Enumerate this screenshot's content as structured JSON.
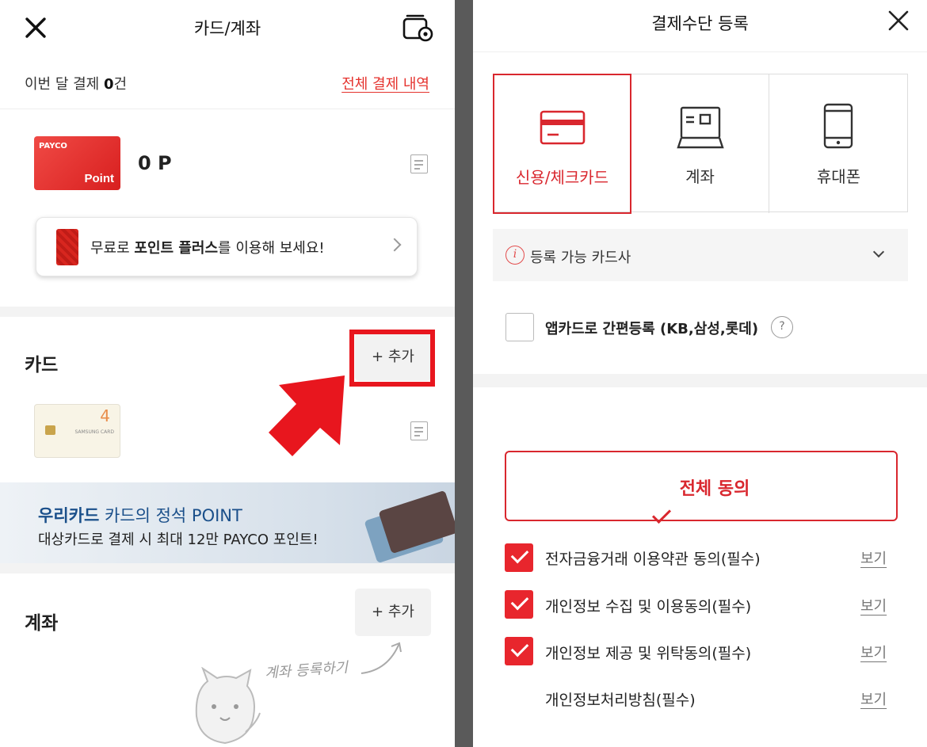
{
  "left": {
    "header": {
      "title": "카드/계좌"
    },
    "summary": {
      "prefix": "이번 달 결제 ",
      "count": "0",
      "suffix": "건",
      "history_link": "전체 결제 내역"
    },
    "point": {
      "card_brand": "PAYCO",
      "card_word": "Point",
      "value": "0 P"
    },
    "promo": {
      "text_pre": "무료로 ",
      "text_bold": "포인트 플러스",
      "text_post": "를 이용해 보세요!"
    },
    "card_section": {
      "title": "카드",
      "add_label": "+ 추가",
      "card_number_label": "4",
      "card_brand_label": "SAMSUNG CARD"
    },
    "banner": {
      "brand": "우리카드",
      "headline_rest": " 카드의 정석 POINT",
      "subline": "대상카드로 결제 시 최대 12만 PAYCO 포인트!"
    },
    "account_section": {
      "title": "계좌",
      "add_label": "+ 추가",
      "hint": "계좌 등록하기"
    }
  },
  "right": {
    "header": {
      "title": "결제수단 등록"
    },
    "tabs": [
      {
        "label": "신용/체크카드",
        "icon": "credit-card-icon",
        "active": true
      },
      {
        "label": "계좌",
        "icon": "bank-account-icon",
        "active": false
      },
      {
        "label": "휴대폰",
        "icon": "mobile-phone-icon",
        "active": false
      }
    ],
    "issuer_dropdown": {
      "label": "등록 가능 카드사"
    },
    "app_card": {
      "label": "앱카드로 간편등록 (KB,삼성,롯데)",
      "help": "?"
    },
    "agree_all": {
      "label": "전체 동의"
    },
    "terms": [
      {
        "label": "전자금융거래 이용약관 동의(필수)",
        "checked": true,
        "view": "보기"
      },
      {
        "label": "개인정보 수집 및 이용동의(필수)",
        "checked": true,
        "view": "보기"
      },
      {
        "label": "개인정보 제공 및 위탁동의(필수)",
        "checked": true,
        "view": "보기"
      },
      {
        "label": "개인정보처리방침(필수)",
        "checked": false,
        "view": "보기"
      }
    ]
  },
  "colors": {
    "accent": "#e8262d",
    "link": "#e5322d",
    "highlight": "#e8161e",
    "banner_brand": "#1a4f8a"
  }
}
